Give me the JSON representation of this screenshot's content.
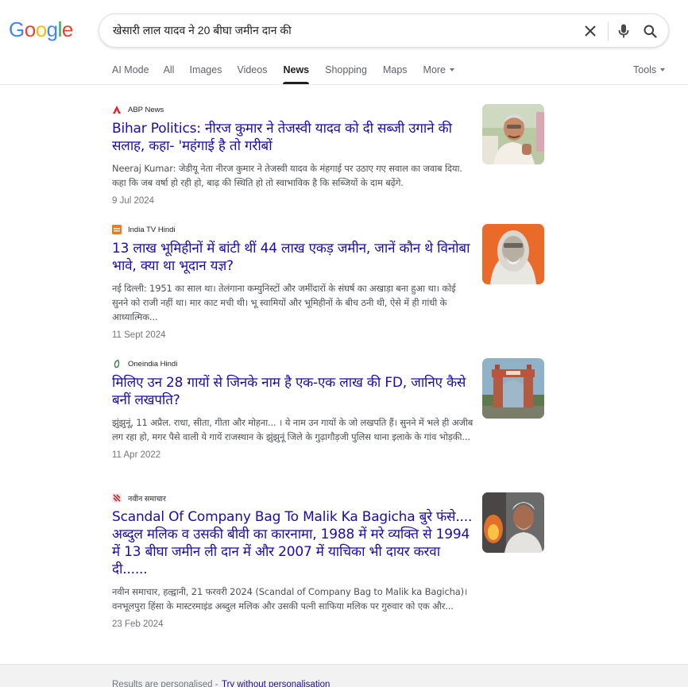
{
  "header": {
    "logo": [
      "G",
      "o",
      "o",
      "g",
      "l",
      "e"
    ],
    "logo_colors": [
      "#4285f4",
      "#ea4335",
      "#fbbc05",
      "#4285f4",
      "#34a853",
      "#ea4335"
    ],
    "search_value": "खेसारी लाल यादव ने 20 बीघा जमीन दान की"
  },
  "tabs": [
    {
      "label": "AI Mode"
    },
    {
      "label": "All"
    },
    {
      "label": "Images"
    },
    {
      "label": "Videos"
    },
    {
      "label": "News"
    },
    {
      "label": "Shopping"
    },
    {
      "label": "Maps"
    },
    {
      "label": "More"
    }
  ],
  "active_tab": "News",
  "tools_label": "Tools",
  "results": [
    {
      "source": "ABP News",
      "favicon": "abp-news-icon",
      "title": "Bihar Politics: नीरज कुमार ने तेजस्वी यादव को दी सब्जी उगाने की सलाह, कहा- 'महंगाई है तो गरीबों",
      "snippet": "Neeraj Kumar: जेडीयू नेता नीरज कुमार ने तेजस्वी यादव के मंहगाई पर उठाए गए सवाल का जवाब दिया. कहा कि जब वर्षा हो रही हो, बाढ़ की स्थिति हो तो स्वाभाविक है कि सब्जियों के दाम बढ़ेंगे.",
      "date": "9 Jul 2024",
      "thumb": "politician-photo"
    },
    {
      "source": "India TV Hindi",
      "favicon": "india-tv-icon",
      "title": "13 लाख भूमिहीनों में बांटी थीं 44 लाख एकड़ जमीन, जानें कौन थे विनोबा भावे, क्या था भूदान यज्ञ?",
      "snippet": "नई दिल्ली: 1951 का साल था। तेलंगाना कम्युनिस्टों और जमींदारों के संघर्ष का अखाड़ा बना हुआ था। कोई सुनने को राजी नहीं था। मार काट मची थी। भू स्वामियों और भूमिहीनों के बीच ठनी थी, ऐसे में ही गांधी के आध्यात्मिक...",
      "date": "11 Sept 2024",
      "thumb": "vinoba-bhave-portrait"
    },
    {
      "source": "Oneindia Hindi",
      "favicon": "oneindia-icon",
      "title": "मिलिए उन 28 गायों से जिनके नाम है एक-एक लाख की FD, जानिए कैसे बनीं लखपति?",
      "snippet": "झुंझुनूं, 11 अप्रैल. राधा, सीता, गीता और मोहना... । ये नाम उन गायों के जो लखपति हैं। सुनने में भले ही अजीब लग रहा हो, मगर पैसे वाली ये गायें राजस्थान के झुंझुनूं जिले के गुढ़ागौड़जी पुलिस थाना इलाके के गांव भोड़की...",
      "date": "11 Apr 2022",
      "thumb": "gate-photo"
    },
    {
      "source": "नवीन समाचार",
      "favicon": "naveen-samachar-icon",
      "title": "Scandal Of Company Bag To Malik Ka Bagicha बुरे फंसे.... अब्दुल मलिक व उसकी बीवी का कारनामा, 1988 में मरे व्यक्ति से 1994 में 13 बीघा जमीन ली दान में और 2007 में याचिका भी दायर करवा दी......",
      "snippet": "नवीन समाचार, हल्द्वानी, 21 फरवरी 2024 (Scandal of Company Bag to Malik ka Bagicha)। वनभूलपुरा हिंसा के मास्टरमाइंड अब्दुल मलिक और उसकी पत्नी साफिया मलिक पर गुरुवार को एक और...",
      "date": "23 Feb 2024",
      "thumb": "man-fire-photo"
    }
  ],
  "footer": {
    "text": "Results are personalised",
    "dash": "-",
    "link": "Try without personalisation"
  }
}
